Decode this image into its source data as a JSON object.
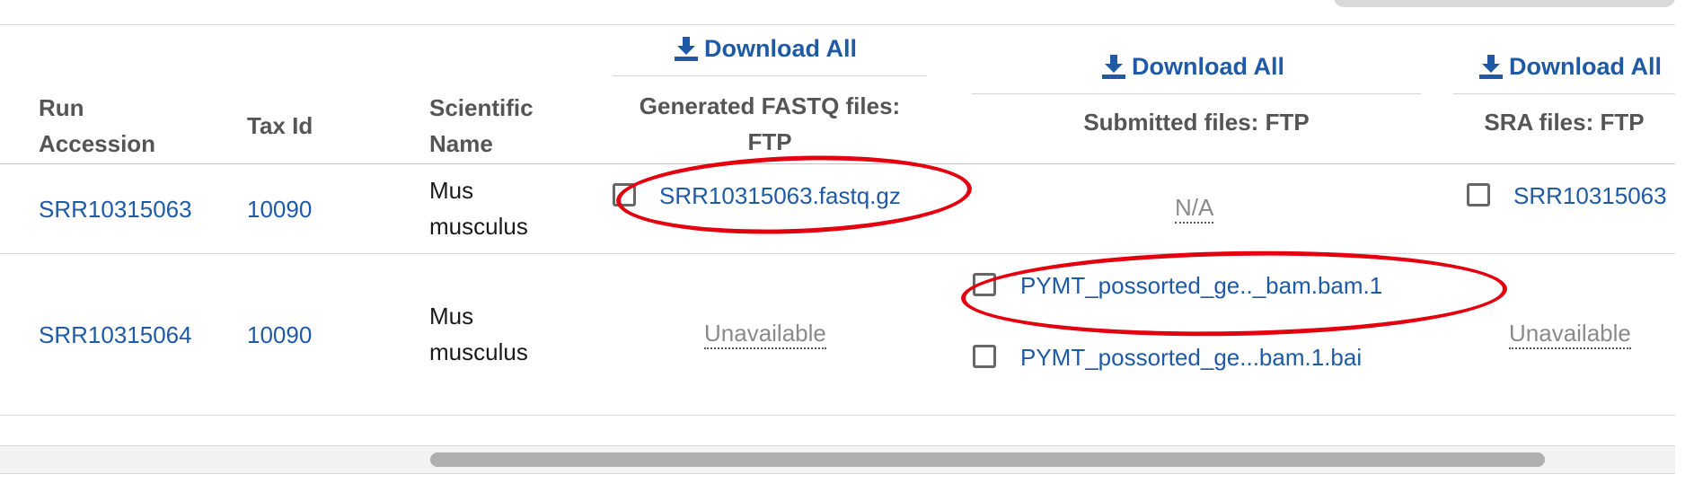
{
  "headers": {
    "run_accession": "Run\nAccession",
    "tax_id": "Tax Id",
    "scientific_name": "Scientific\nName",
    "generated_fastq": "Generated FASTQ files:\nFTP",
    "submitted_files": "Submitted files: FTP",
    "sra_files": "SRA files: FTP",
    "download_all": "Download All"
  },
  "rows": [
    {
      "run_accession": "SRR10315063",
      "tax_id": "10090",
      "scientific_name": "Mus\nmusculus",
      "fastq_file": "SRR10315063.fastq.gz",
      "submitted_status": "N/A",
      "sra_file": "SRR10315063"
    },
    {
      "run_accession": "SRR10315064",
      "tax_id": "10090",
      "scientific_name": "Mus\nmusculus",
      "fastq_status": "Unavailable",
      "submitted_files": [
        "PYMT_possorted_ge.._bam.bam.1",
        "PYMT_possorted_ge...bam.1.bai"
      ],
      "sra_status": "Unavailable"
    }
  ],
  "colors": {
    "link": "#1f5aa6",
    "header_text": "#555555",
    "annotation": "#e3000f"
  },
  "icons": {
    "download": "download-icon"
  },
  "scrollbar": {
    "position_fraction": 0.44
  }
}
